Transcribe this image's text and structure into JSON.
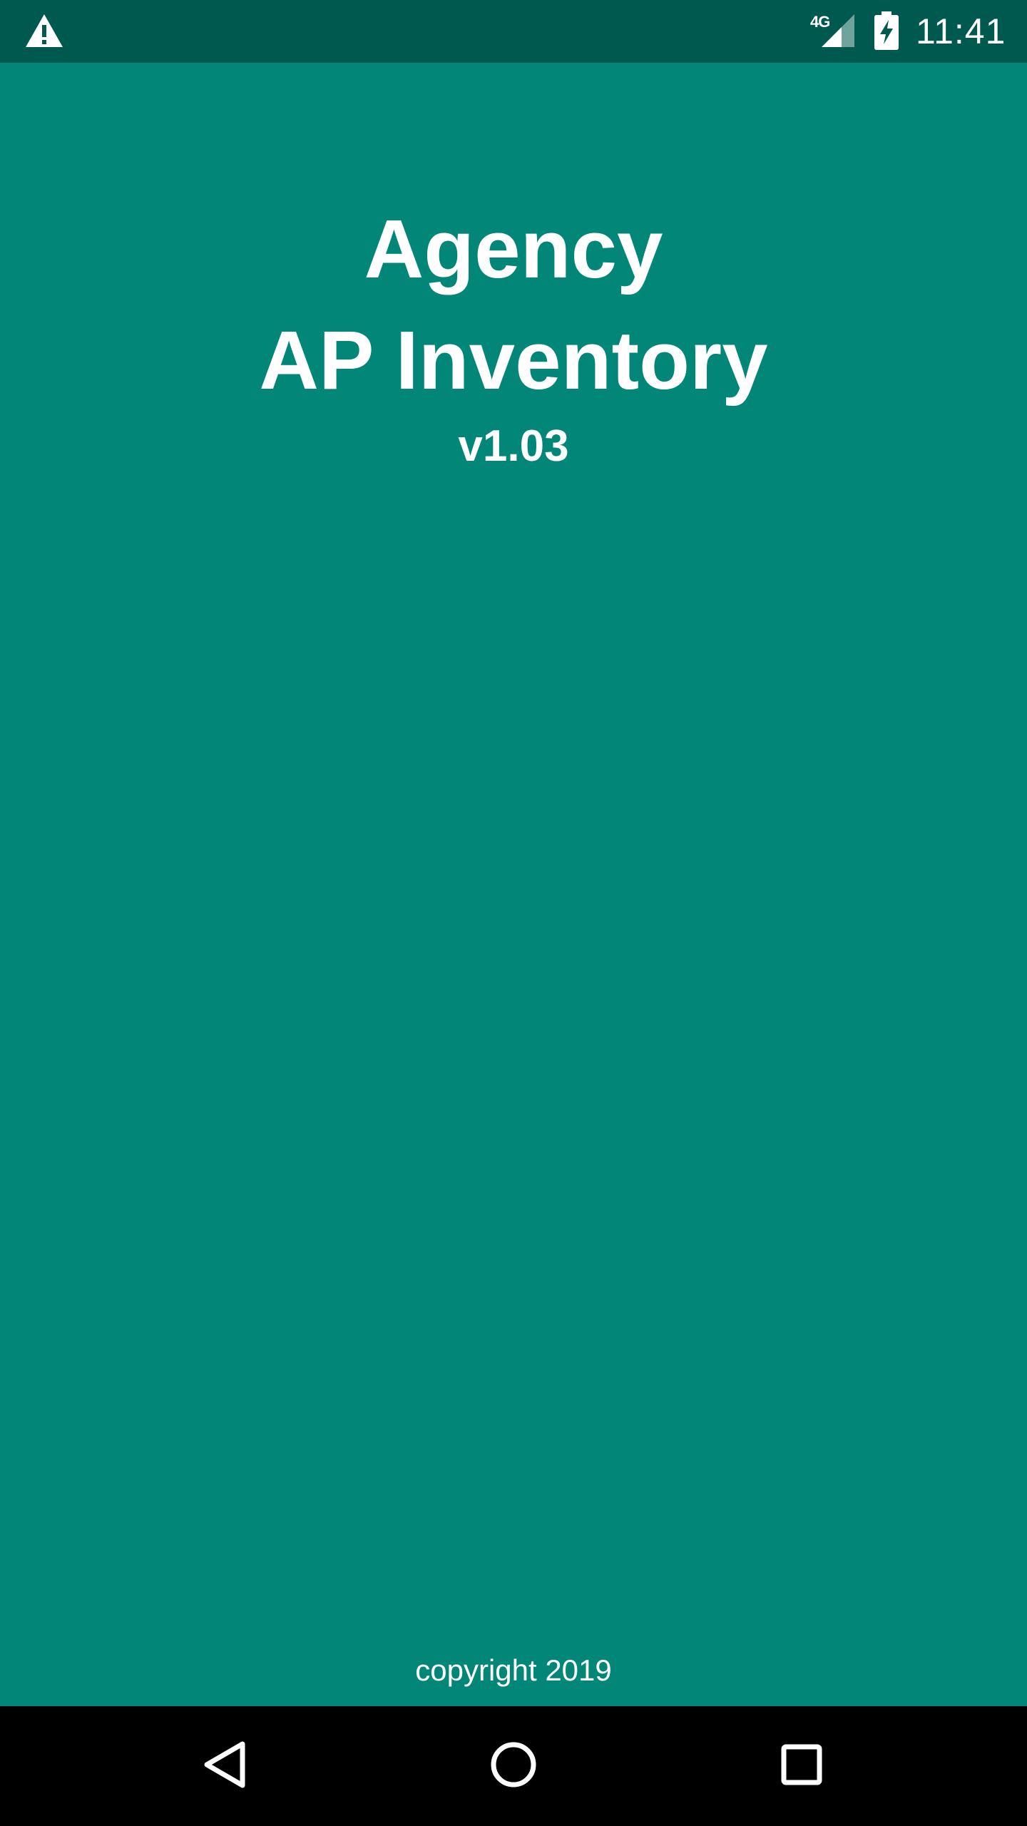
{
  "status_bar": {
    "network_type": "4G",
    "time": "11:41",
    "icons": [
      "warning-icon",
      "signal-icon",
      "battery-charging-icon"
    ],
    "background_color": "#00594f"
  },
  "splash": {
    "title_line1": "Agency",
    "title_line2": "AP Inventory",
    "version": "v1.03",
    "copyright": "copyright 2019",
    "background_color": "#028677",
    "text_color": "#ffffff"
  },
  "nav_bar": {
    "buttons": [
      {
        "name": "back",
        "icon": "back-triangle-icon"
      },
      {
        "name": "home",
        "icon": "home-circle-icon"
      },
      {
        "name": "recents",
        "icon": "recents-square-icon"
      }
    ],
    "background_color": "#000000"
  }
}
